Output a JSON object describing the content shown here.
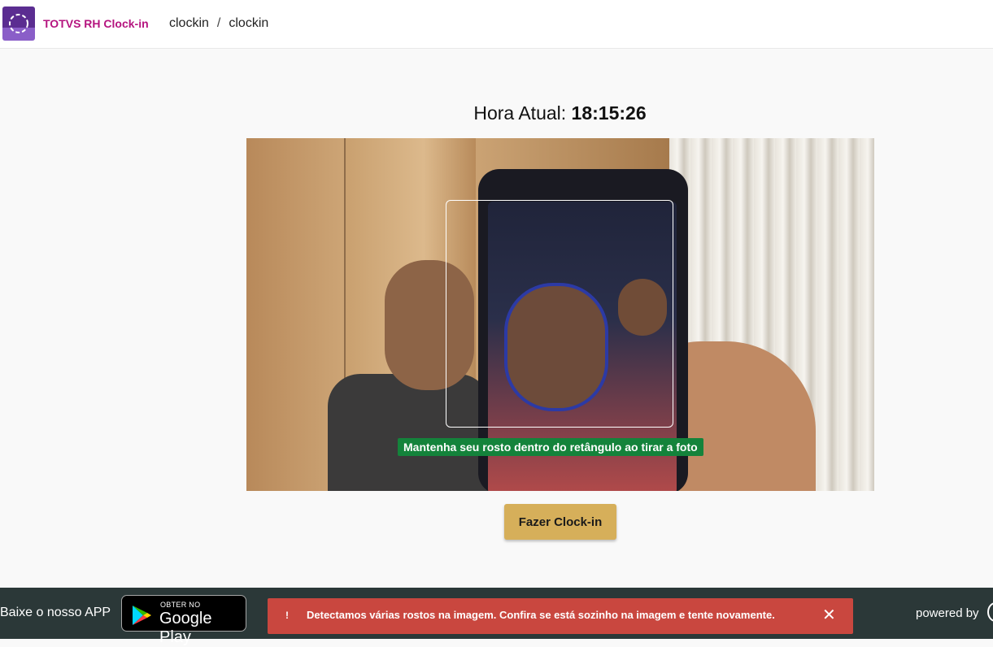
{
  "header": {
    "logo_icon": "totvs-logo-icon",
    "app_name": "TOTVS RH Clock-in",
    "breadcrumb": [
      "clockin",
      "clockin"
    ],
    "breadcrumb_separator": "/"
  },
  "main": {
    "time_label": "Hora Atual:",
    "time_value": "18:15:26",
    "camera_hint": "Mantenha seu rosto dentro do retângulo ao tirar a foto",
    "clockin_button": "Fazer Clock-in"
  },
  "footer": {
    "download_text": "Baixe o nosso APP",
    "store_badge": {
      "top": "OBTER NO",
      "main": "Google Play"
    },
    "toast": {
      "mark": "!",
      "message": "Detectamos várias rostos na imagem. Confira se está sozinho na imagem e tente novamente.",
      "close": "✕"
    },
    "powered_by": "powered by"
  },
  "colors": {
    "brand_purple": "#5b2d91",
    "app_name_color": "#b5147f",
    "hint_green": "#14833b",
    "button_gold": "#d6af5a",
    "footer_bg": "#2b3838",
    "toast_red": "#c9473f"
  }
}
